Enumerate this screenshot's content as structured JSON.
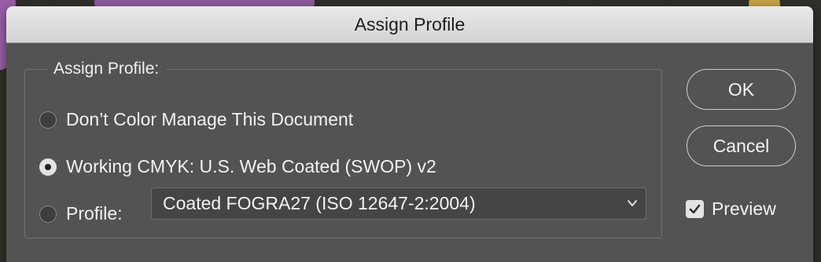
{
  "dialog": {
    "title": "Assign Profile"
  },
  "group": {
    "legend": "Assign Profile:"
  },
  "options": [
    {
      "label": "Don’t Color Manage This Document",
      "selected": false
    },
    {
      "label": "Working CMYK:  U.S. Web Coated (SWOP) v2",
      "selected": true
    },
    {
      "label": "Profile:",
      "selected": false
    }
  ],
  "profile_select": {
    "value": "Coated FOGRA27 (ISO 12647-2:2004)",
    "icon": "chevron-down-icon"
  },
  "buttons": {
    "ok": "OK",
    "cancel": "Cancel"
  },
  "preview": {
    "label": "Preview",
    "checked": true,
    "icon": "checkmark-icon"
  },
  "colors": {
    "dialog_bg": "#535353",
    "titlebar_bg": "#d9d9d9",
    "text": "#f2f2f2"
  }
}
